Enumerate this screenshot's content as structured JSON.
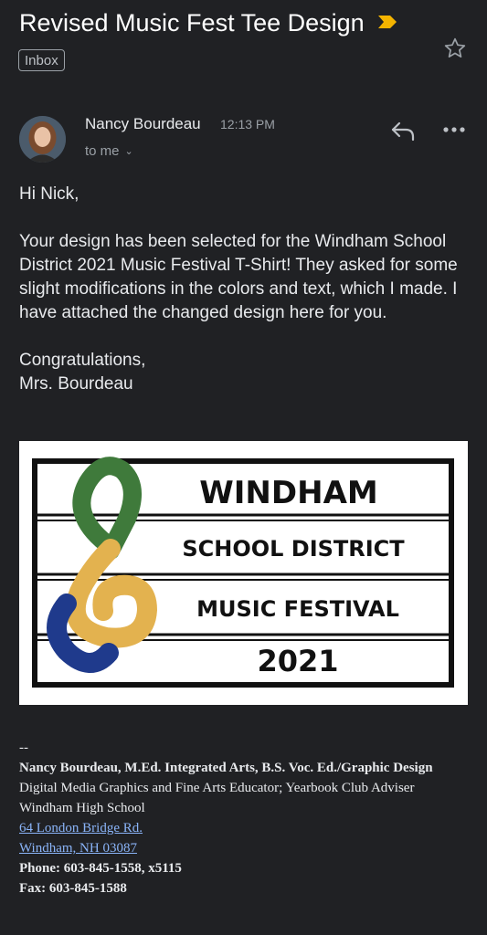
{
  "email": {
    "subject": "Revised Music Fest Tee Design",
    "label": "Inbox",
    "sender_name": "Nancy Bourdeau",
    "time": "12:13 PM",
    "recipient": "to me",
    "icons": {
      "important": "important-marker-icon",
      "star": "star-icon",
      "reply": "reply-icon",
      "more": "more-icon",
      "chevron": "chevron-down-icon"
    },
    "colors": {
      "important_marker": "#f4b400",
      "link": "#8ab4f8",
      "background": "#202124"
    }
  },
  "body": {
    "greeting": "Hi Nick,",
    "paragraph": "Your design has been selected for the Windham School District 2021 Music Festival T-Shirt! They asked for some slight modifications in the colors and text, which I made. I have attached the changed design here for you.",
    "closing": "Congratulations,",
    "signoff": "Mrs. Bourdeau"
  },
  "attachment": {
    "line1": "WINDHAM",
    "line2": "SCHOOL DISTRICT",
    "line3": "MUSIC FESTIVAL",
    "line4": "2021",
    "colors": {
      "green": "#3f7a3b",
      "gold": "#e3b24f",
      "navy": "#1f3a8c"
    }
  },
  "signature": {
    "separator": "--",
    "name_line": "Nancy Bourdeau, M.Ed. Integrated Arts, B.S. Voc. Ed./Graphic Design",
    "title": "Digital Media Graphics and Fine Arts Educator; Yearbook Club Adviser",
    "school": "Windham High School",
    "address1": "64 London Bridge Rd.",
    "address2": "Windham, NH 03087",
    "phone": "Phone: 603-845-1558, x5115",
    "fax": "Fax: 603-845-1588"
  }
}
